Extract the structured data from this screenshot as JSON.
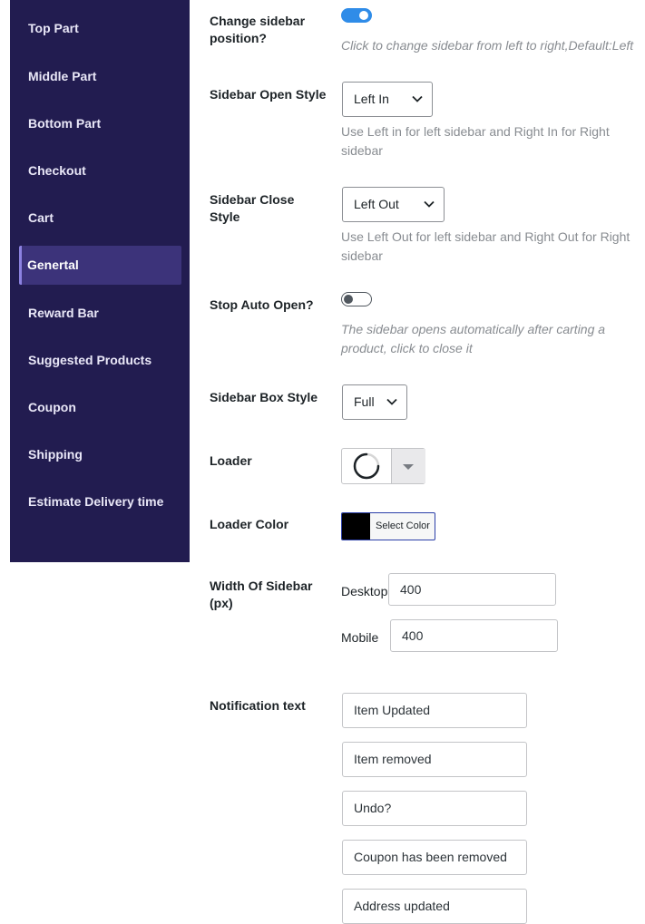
{
  "nav": {
    "items": [
      {
        "label": "Top Part"
      },
      {
        "label": "Middle Part"
      },
      {
        "label": "Bottom Part"
      },
      {
        "label": "Checkout"
      },
      {
        "label": "Cart"
      },
      {
        "label": "Genertal",
        "active": true
      },
      {
        "label": "Reward Bar"
      },
      {
        "label": "Suggested Products"
      },
      {
        "label": "Coupon"
      },
      {
        "label": "Shipping"
      },
      {
        "label": "Estimate Delivery time"
      }
    ]
  },
  "settings": {
    "sidebar_position": {
      "label": "Change sidebar position?",
      "enabled": true,
      "description": "Click to change sidebar from left to right,Default:Left"
    },
    "open_style": {
      "label": "Sidebar Open Style",
      "value": "Left In",
      "description": "Use Left in for left sidebar and Right In for Right sidebar"
    },
    "close_style": {
      "label": "Sidebar Close Style",
      "value": "Left Out",
      "description": "Use Left Out for left sidebar and Right Out for Right sidebar"
    },
    "auto_open": {
      "label": "Stop Auto Open?",
      "enabled": false,
      "description": "The sidebar opens automatically after carting a product, click to close it"
    },
    "box_style": {
      "label": "Sidebar Box Style",
      "value": "Full"
    },
    "loader": {
      "label": "Loader",
      "icon": "spinner-icon"
    },
    "loader_color": {
      "label": "Loader Color",
      "button_label": "Select Color",
      "color": "#000000"
    },
    "sidebar_width": {
      "label": "Width Of Sidebar (px)",
      "desktop_label": "Desktop",
      "desktop_value": "400",
      "mobile_label": "Mobile",
      "mobile_value": "400"
    },
    "notification": {
      "label": "Notification text",
      "values": [
        "Item Updated",
        "Item removed",
        "Undo?",
        "Coupon has been removed",
        "Address updated"
      ]
    }
  },
  "colors": {
    "sidebar_bg": "#221c50",
    "active_bg": "#3c337a",
    "toggle_on": "#2f8ce8"
  }
}
